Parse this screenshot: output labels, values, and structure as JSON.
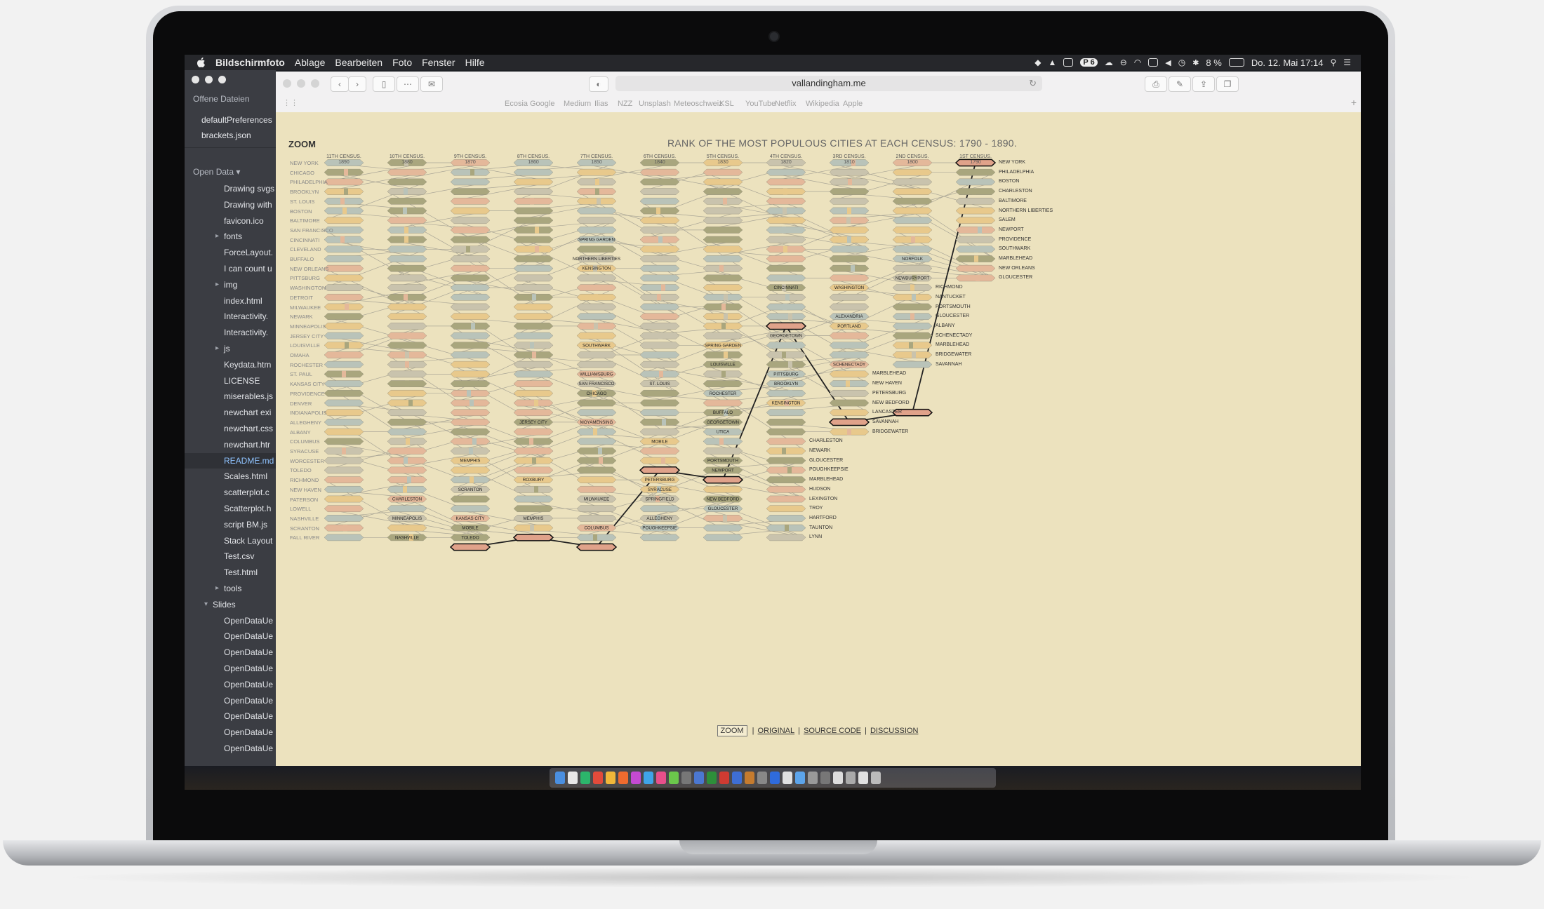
{
  "menubar": {
    "app_name": "Bildschirmfoto",
    "items": [
      "Ablage",
      "Bearbeiten",
      "Foto",
      "Fenster",
      "Hilfe"
    ],
    "status": {
      "badge": "6",
      "battery": "8 %",
      "datetime": "Do. 12. Mai 17:14"
    }
  },
  "editor": {
    "open_files_title": "Offene Dateien",
    "open_files": [
      "defaultPreferences",
      "brackets.json"
    ],
    "project_title": "Open Data ▾",
    "tree": [
      {
        "label": "Drawing svgs",
        "kind": "file"
      },
      {
        "label": "Drawing with",
        "kind": "file"
      },
      {
        "label": "favicon.ico",
        "kind": "file"
      },
      {
        "label": "fonts",
        "kind": "folder"
      },
      {
        "label": "ForceLayout.",
        "kind": "file"
      },
      {
        "label": "I can count u",
        "kind": "file"
      },
      {
        "label": "img",
        "kind": "folder"
      },
      {
        "label": "index.html",
        "kind": "file"
      },
      {
        "label": "Interactivity.",
        "kind": "file"
      },
      {
        "label": "Interactivity.",
        "kind": "file"
      },
      {
        "label": "js",
        "kind": "folder"
      },
      {
        "label": "Keydata.htm",
        "kind": "file"
      },
      {
        "label": "LICENSE",
        "kind": "file"
      },
      {
        "label": "miserables.js",
        "kind": "file"
      },
      {
        "label": "newchart exi",
        "kind": "file"
      },
      {
        "label": "newchart.css",
        "kind": "file"
      },
      {
        "label": "newchart.htr",
        "kind": "file"
      },
      {
        "label": "README.md",
        "kind": "file",
        "selected": true
      },
      {
        "label": "Scales.html",
        "kind": "file"
      },
      {
        "label": "scatterplot.c",
        "kind": "file"
      },
      {
        "label": "Scatterplot.h",
        "kind": "file"
      },
      {
        "label": "script BM.js",
        "kind": "file"
      },
      {
        "label": "Stack Layout",
        "kind": "file"
      },
      {
        "label": "Test.csv",
        "kind": "file"
      },
      {
        "label": "Test.html",
        "kind": "file"
      },
      {
        "label": "tools",
        "kind": "folder"
      },
      {
        "label": "Slides",
        "kind": "open"
      },
      {
        "label": "OpenDataUe",
        "kind": "file"
      },
      {
        "label": "OpenDataUe",
        "kind": "file"
      },
      {
        "label": "OpenDataUe",
        "kind": "file"
      },
      {
        "label": "OpenDataUe",
        "kind": "file"
      },
      {
        "label": "OpenDataUe",
        "kind": "file"
      },
      {
        "label": "OpenDataUe",
        "kind": "file"
      },
      {
        "label": "OpenDataUe",
        "kind": "file"
      },
      {
        "label": "OpenDataUe",
        "kind": "file"
      },
      {
        "label": "OpenDataUe",
        "kind": "file"
      }
    ]
  },
  "browser": {
    "url": "vallandingham.me",
    "favorites": [
      "Ecosia",
      "Google",
      "Medium",
      "Ilias",
      "NZZ",
      "Unsplash",
      "Meteoschweiz",
      "KSL",
      "YouTube",
      "Netflix",
      "Wikipedia",
      "Apple"
    ]
  },
  "page": {
    "zoom_label": "ZOOM",
    "title": "RANK OF THE MOST POPULOUS CITIES AT EACH CENSUS: 1790 - 1890.",
    "censuses": [
      {
        "name": "11TH CENSUS.",
        "year": "1890"
      },
      {
        "name": "10TH CENSUS.",
        "year": "1880"
      },
      {
        "name": "9TH CENSUS.",
        "year": "1870"
      },
      {
        "name": "8TH CENSUS.",
        "year": "1860"
      },
      {
        "name": "7TH CENSUS.",
        "year": "1850"
      },
      {
        "name": "6TH CENSUS.",
        "year": "1840"
      },
      {
        "name": "5TH CENSUS.",
        "year": "1830"
      },
      {
        "name": "4TH CENSUS.",
        "year": "1820"
      },
      {
        "name": "3RD CENSUS.",
        "year": "1810"
      },
      {
        "name": "2ND CENSUS.",
        "year": "1800"
      },
      {
        "name": "1ST CENSUS.",
        "year": "1790"
      }
    ],
    "cities_1890": [
      "NEW YORK",
      "CHICAGO",
      "PHILADELPHIA",
      "BROOKLYN",
      "ST. LOUIS",
      "BOSTON",
      "BALTIMORE",
      "SAN FRANCISCO",
      "CINCINNATI",
      "CLEVELAND",
      "BUFFALO",
      "NEW ORLEANS",
      "PITTSBURG",
      "WASHINGTON",
      "DETROIT",
      "MILWAUKEE",
      "NEWARK",
      "MINNEAPOLIS",
      "JERSEY CITY",
      "LOUISVILLE",
      "OMAHA",
      "ROCHESTER",
      "ST. PAUL",
      "KANSAS CITY",
      "PROVIDENCE",
      "DENVER",
      "INDIANAPOLIS",
      "ALLEGHENY",
      "ALBANY",
      "COLUMBUS",
      "SYRACUSE",
      "WORCESTER",
      "TOLEDO",
      "RICHMOND",
      "NEW HAVEN",
      "PATERSON",
      "LOWELL",
      "NASHVILLE",
      "SCRANTON",
      "FALL RIVER"
    ],
    "cities_1790": [
      "NEW YORK",
      "PHILADELPHIA",
      "BOSTON",
      "CHARLESTON",
      "BALTIMORE",
      "NORTHERN LIBERTIES",
      "SALEM",
      "NEWPORT",
      "PROVIDENCE",
      "SOUTHWARK",
      "MARBLEHEAD",
      "NEW ORLEANS",
      "GLOUCESTER"
    ],
    "cities_1800_extra": [
      "RICHMOND",
      "NANTUCKET",
      "PORTSMOUTH",
      "GLOUCESTER",
      "ALBANY",
      "SCHENECTADY",
      "MARBLEHEAD",
      "BRIDGEWATER",
      "SAVANNAH"
    ],
    "cities_1810_extra": [
      "MARBLEHEAD",
      "NEW HAVEN",
      "PETERSBURG",
      "NEW BEDFORD",
      "LANCASTER",
      "SAVANNAH",
      "BRIDGEWATER"
    ],
    "cities_1820_extra": [
      "CHARLESTON",
      "NEWARK",
      "GLOUCESTER",
      "POUGHKEEPSIE",
      "MARBLEHEAD",
      "HUDSON",
      "LEXINGTON",
      "TROY",
      "HARTFORD",
      "TAUNTON",
      "LYNN"
    ],
    "inline_labels": [
      {
        "col": 4,
        "row": 8,
        "text": "SPRING GARDEN"
      },
      {
        "col": 4,
        "row": 10,
        "text": "NORTHERN LIBERTIES"
      },
      {
        "col": 4,
        "row": 11,
        "text": "KENSINGTON"
      },
      {
        "col": 4,
        "row": 19,
        "text": "SOUTHWARK"
      },
      {
        "col": 4,
        "row": 22,
        "text": "WILLIAMSBURG"
      },
      {
        "col": 4,
        "row": 23,
        "text": "SAN FRANCISCO"
      },
      {
        "col": 4,
        "row": 24,
        "text": "CHICAGO"
      },
      {
        "col": 4,
        "row": 27,
        "text": "MOYAMENSING"
      },
      {
        "col": 4,
        "row": 35,
        "text": "MILWAUKEE"
      },
      {
        "col": 4,
        "row": 38,
        "text": "COLUMBUS"
      },
      {
        "col": 3,
        "row": 27,
        "text": "JERSEY CITY"
      },
      {
        "col": 3,
        "row": 33,
        "text": "ROXBURY"
      },
      {
        "col": 3,
        "row": 37,
        "text": "MEMPHIS"
      },
      {
        "col": 2,
        "row": 31,
        "text": "MEMPHIS"
      },
      {
        "col": 2,
        "row": 34,
        "text": "SCRANTON"
      },
      {
        "col": 2,
        "row": 37,
        "text": "KANSAS CITY"
      },
      {
        "col": 2,
        "row": 38,
        "text": "MOBILE"
      },
      {
        "col": 2,
        "row": 39,
        "text": "TOLEDO"
      },
      {
        "col": 1,
        "row": 35,
        "text": "CHARLESTON"
      },
      {
        "col": 1,
        "row": 37,
        "text": "MINNEAPOLIS"
      },
      {
        "col": 1,
        "row": 39,
        "text": "NASHVILLE"
      },
      {
        "col": 5,
        "row": 23,
        "text": "ST. LOUIS"
      },
      {
        "col": 5,
        "row": 29,
        "text": "MOBILE"
      },
      {
        "col": 5,
        "row": 33,
        "text": "PETERSBURG"
      },
      {
        "col": 5,
        "row": 34,
        "text": "SYRACUSE"
      },
      {
        "col": 5,
        "row": 35,
        "text": "SPRINGFIELD"
      },
      {
        "col": 5,
        "row": 37,
        "text": "ALLEGHENY"
      },
      {
        "col": 5,
        "row": 38,
        "text": "POUGHKEEPSIE"
      },
      {
        "col": 6,
        "row": 19,
        "text": "SPRING GARDEN"
      },
      {
        "col": 6,
        "row": 21,
        "text": "LOUISVILLE"
      },
      {
        "col": 6,
        "row": 24,
        "text": "ROCHESTER"
      },
      {
        "col": 6,
        "row": 26,
        "text": "BUFFALO"
      },
      {
        "col": 6,
        "row": 27,
        "text": "GEORGETOWN"
      },
      {
        "col": 6,
        "row": 28,
        "text": "UTICA"
      },
      {
        "col": 6,
        "row": 31,
        "text": "PORTSMOUTH"
      },
      {
        "col": 6,
        "row": 32,
        "text": "NEWPORT"
      },
      {
        "col": 6,
        "row": 35,
        "text": "NEW BEDFORD"
      },
      {
        "col": 6,
        "row": 36,
        "text": "GLOUCESTER"
      },
      {
        "col": 7,
        "row": 13,
        "text": "CINCINNATI"
      },
      {
        "col": 7,
        "row": 18,
        "text": "GEORGETOWN"
      },
      {
        "col": 7,
        "row": 22,
        "text": "PITTSBURG"
      },
      {
        "col": 7,
        "row": 23,
        "text": "BROOKLYN"
      },
      {
        "col": 7,
        "row": 25,
        "text": "KENSINGTON"
      },
      {
        "col": 8,
        "row": 13,
        "text": "WASHINGTON"
      },
      {
        "col": 8,
        "row": 16,
        "text": "ALEXANDRIA"
      },
      {
        "col": 8,
        "row": 17,
        "text": "PORTLAND"
      },
      {
        "col": 8,
        "row": 21,
        "text": "SCHENECTADY"
      },
      {
        "col": 9,
        "row": 10,
        "text": "NORFOLK"
      },
      {
        "col": 9,
        "row": 12,
        "text": "NEWBURYPORT"
      }
    ],
    "footer": {
      "zoom": "ZOOM",
      "links": [
        "ORIGINAL",
        "SOURCE CODE",
        "DISCUSSION"
      ],
      "separator": "|"
    }
  },
  "colors": {
    "background": "#ece2be",
    "shape_blue": "#b9c3b9",
    "shape_peach": "#e4b89a",
    "shape_sand": "#e8c98c",
    "shape_olive": "#a9a67e",
    "shape_gray": "#c9c3ad",
    "highlight": "#e0a28a"
  }
}
